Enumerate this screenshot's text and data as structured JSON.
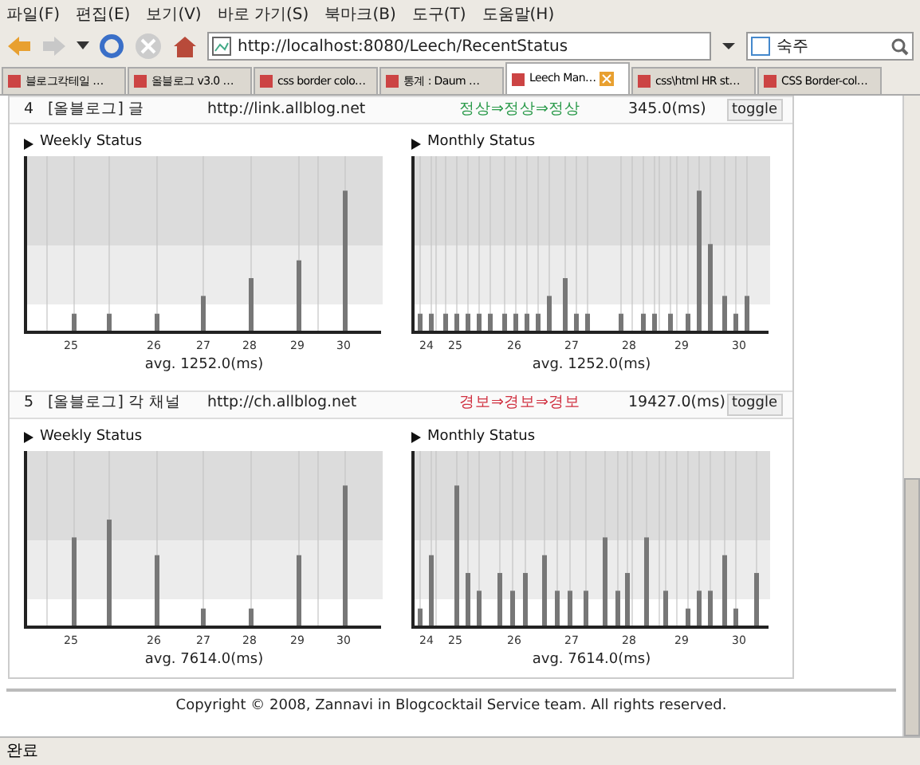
{
  "menu": [
    "파일(F)",
    "편집(E)",
    "보기(V)",
    "바로 가기(S)",
    "북마크(B)",
    "도구(T)",
    "도움말(H)"
  ],
  "address": {
    "value": "http://localhost:8080/Leech/RecentStatus"
  },
  "search": {
    "value": "숙주"
  },
  "tabs": [
    {
      "label": "블로그칵테일 …",
      "selected": false
    },
    {
      "label": "올블로그 v3.0 …",
      "selected": false
    },
    {
      "label": "css border colo…",
      "selected": false
    },
    {
      "label": "통계 : Daum …",
      "selected": false
    },
    {
      "label": "Leech Man…",
      "selected": true
    },
    {
      "label": "css\\html HR st…",
      "selected": false
    },
    {
      "label": "CSS Border-col…",
      "selected": false
    }
  ],
  "rows": [
    {
      "number": "4",
      "name": "[올블로그] 글",
      "url": "http://link.allblog.net",
      "status": "정상⇒정상⇒정상",
      "kind": "ok",
      "time": "345.0(ms)",
      "button": "toggle",
      "weekly": {
        "title": "Weekly Status",
        "x_labels": [
          "25",
          "26",
          "27",
          "28",
          "29",
          "30"
        ],
        "average": "avg. 1252.0(ms)"
      },
      "monthly": {
        "title": "Monthly Status",
        "x_labels": [
          "24",
          "25",
          "26",
          "27",
          "28",
          "29",
          "30"
        ],
        "average": "avg. 1252.0(ms)"
      }
    },
    {
      "number": "5",
      "name": "[올블로그] 각 채널",
      "url": "http://ch.allblog.net",
      "status": "경보⇒경보⇒경보",
      "kind": "alert",
      "time": "19427.0(ms)",
      "button": "toggle",
      "weekly": {
        "title": "Weekly Status",
        "x_labels": [
          "25",
          "26",
          "27",
          "28",
          "29",
          "30"
        ],
        "average": "avg. 7614.0(ms)"
      },
      "monthly": {
        "title": "Monthly Status",
        "x_labels": [
          "24",
          "25",
          "26",
          "27",
          "28",
          "29",
          "30"
        ],
        "average": "avg. 7614.0(ms)"
      }
    }
  ],
  "footer": "Copyright © 2008, Zannavi in Blogcocktail Service team. All rights reserved.",
  "status_bar": "완료"
}
